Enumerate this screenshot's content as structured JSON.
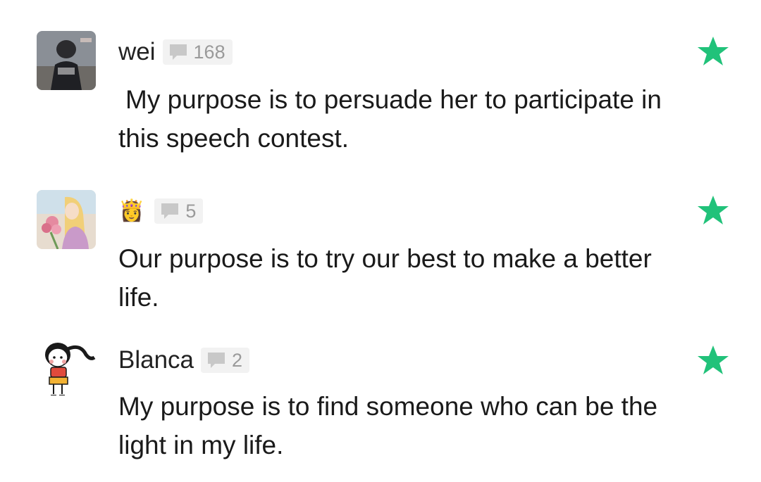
{
  "colors": {
    "star": "#21c27a",
    "badge_bg": "#f2f2f2",
    "badge_text": "#9a9a9a"
  },
  "comments": [
    {
      "username": "wei",
      "reply_count": "168",
      "text": "My purpose is to persuade her to participate in this speech contest.",
      "avatar_icon": "photo-avatar-icon"
    },
    {
      "username": "👸",
      "reply_count": "5",
      "text": "Our purpose is to try our best to make a better life.",
      "avatar_icon": "illustrated-girl-avatar-icon"
    },
    {
      "username": "Blanca",
      "reply_count": "2",
      "text": "My purpose is to find someone who can be the light in my life.",
      "avatar_icon": "cartoon-girl-avatar-icon"
    }
  ]
}
